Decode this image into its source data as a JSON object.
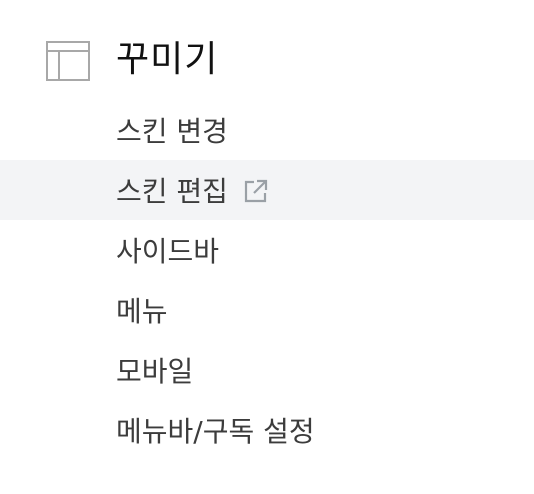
{
  "section": {
    "icon": "layout-icon",
    "title": "꾸미기"
  },
  "menu": {
    "items": [
      {
        "label": "스킨 변경",
        "active": false
      },
      {
        "label": "스킨 편집",
        "active": true,
        "icon": "external-link-icon"
      },
      {
        "label": "사이드바",
        "active": false
      },
      {
        "label": "메뉴",
        "active": false
      },
      {
        "label": "모바일",
        "active": false
      },
      {
        "label": "메뉴바/구독 설정",
        "active": false
      }
    ]
  },
  "colors": {
    "active_background": "#f3f4f6",
    "text": "#3c3c3c",
    "title": "#111111",
    "icon": "#9aa0a6"
  }
}
